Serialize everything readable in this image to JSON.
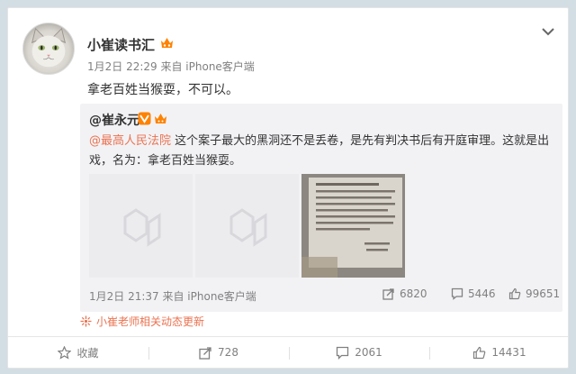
{
  "post": {
    "author": "小崔读书汇",
    "meta": "1月2日 22:29 来自 iPhone客户端",
    "text": "拿老百姓当猴耍，不可以。"
  },
  "repost": {
    "author": "@崔永元",
    "mention": "@最高人民法院",
    "text": " 这个案子最大的黑洞还不是丢卷，是先有判决书后有开庭审理。这就是出戏，名为：拿老百姓当猴耍。",
    "meta": "1月2日 21:37 来自 iPhone客户端",
    "repost_count": "6820",
    "comment_count": "5446",
    "like_count": "99651"
  },
  "related": {
    "label": "小崔老师相关动态更新"
  },
  "actions": {
    "favorite": "收藏",
    "repost": "728",
    "comment": "2061",
    "like": "14431"
  },
  "colors": {
    "accent": "#eb7350",
    "badge_orange": "#ff8200",
    "page_bg": "#d3dde4",
    "repost_bg": "#f2f2f5"
  }
}
